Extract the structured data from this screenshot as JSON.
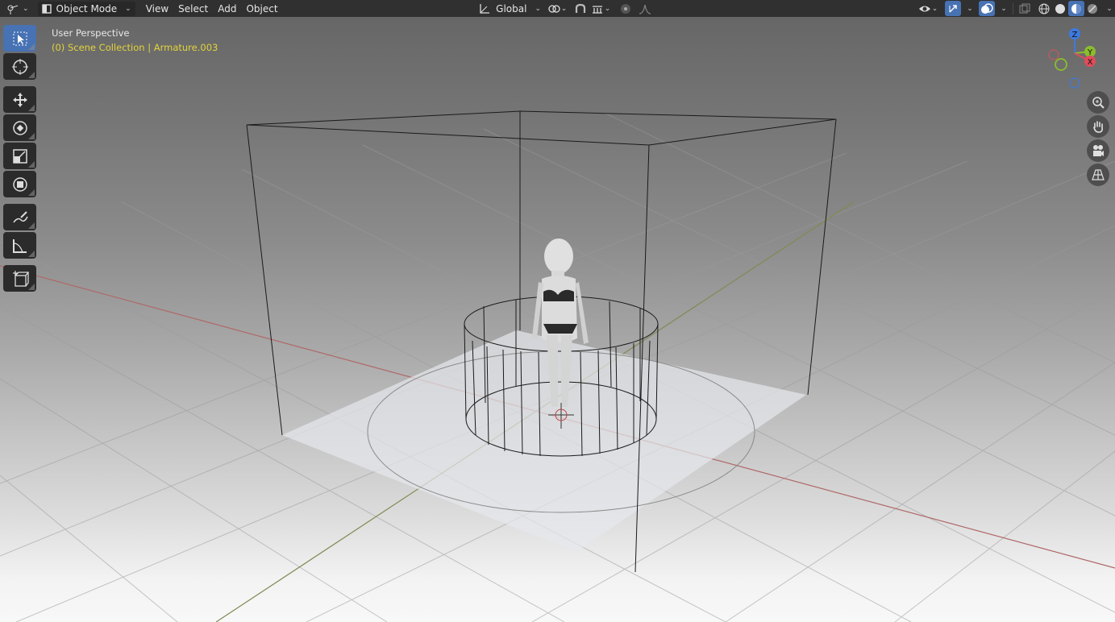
{
  "header": {
    "editor_type_icon": "3d-viewport-icon",
    "mode": "Object Mode",
    "menus": [
      "View",
      "Select",
      "Add",
      "Object"
    ],
    "transform_orientation": "Global",
    "pivot_icon": "pivot-point-icon",
    "snap_icon": "magnet-icon",
    "snap_target_icon": "snap-increment-icon",
    "proportional_icon": "proportional-editing-icon",
    "falloff_icon": "falloff-curve-icon",
    "visibility_icon": "eye-icon",
    "gizmo_icon": "gizmo-icon",
    "overlay_icon": "overlay-icon",
    "xray_icon": "xray-icon",
    "shading_modes": [
      "wireframe",
      "solid",
      "material-preview",
      "rendered"
    ],
    "active_shading": "material-preview"
  },
  "toolbar": {
    "tools": [
      {
        "name": "select-box-tool",
        "icon": "select-cursor-icon",
        "active": true
      },
      {
        "name": "cursor-tool",
        "icon": "3d-cursor-icon"
      },
      {
        "name": "move-tool",
        "icon": "move-arrows-icon"
      },
      {
        "name": "rotate-tool",
        "icon": "rotate-icon"
      },
      {
        "name": "scale-tool",
        "icon": "scale-icon"
      },
      {
        "name": "transform-tool",
        "icon": "transform-icon"
      },
      {
        "name": "annotate-tool",
        "icon": "pencil-icon"
      },
      {
        "name": "measure-tool",
        "icon": "ruler-icon"
      },
      {
        "name": "add-cube-tool",
        "icon": "add-cube-icon"
      }
    ]
  },
  "overlay": {
    "view_name": "User Perspective",
    "collection": "(0) Scene Collection | Armature.003"
  },
  "gizmo": {
    "axes": [
      "X",
      "Y",
      "Z"
    ]
  },
  "navigation": [
    "zoom-icon",
    "hand-pan-icon",
    "camera-icon",
    "perspective-grid-icon"
  ],
  "colors": {
    "header_bg": "#303030",
    "active_blue": "#4772b3",
    "collection_text": "#e3d33b",
    "x_axis": "#e14c5a",
    "y_axis": "#8bbd2d",
    "z_axis": "#3e7ae0"
  }
}
